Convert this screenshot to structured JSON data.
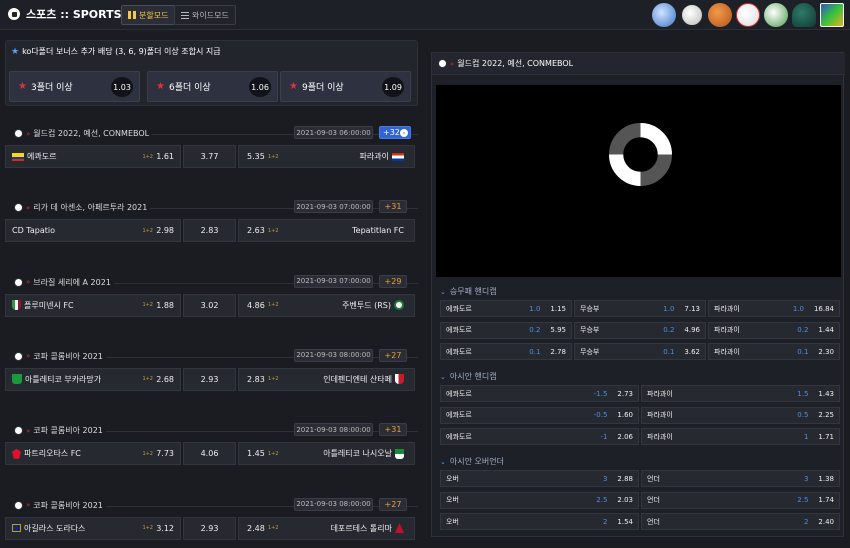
{
  "header": {
    "brand": "스포츠 :: SPORTS",
    "mode_split": "분할모드",
    "mode_wide": "와이드모드",
    "sports_icons": [
      "globe-icon",
      "soccer-ball-icon",
      "basketball-icon",
      "baseball-icon",
      "volleyball-icon",
      "hockey-helmet-icon",
      "esports-icon"
    ]
  },
  "bonus": {
    "title": "ko다폴더 보너스 추가 배당 (3, 6, 9)폴더 이상 조합시 지급",
    "items": [
      {
        "label": "3폴더 이상",
        "odds": "1.03"
      },
      {
        "label": "6폴더 이상",
        "odds": "1.06"
      },
      {
        "label": "9폴더 이상",
        "odds": "1.09"
      }
    ]
  },
  "matches": [
    {
      "league": "월드컵 2022, 예선, CONMEBOL",
      "datetime": "2021-09-03 06:00:00",
      "more": "+32",
      "home": "에콰도르",
      "home_odds": "1.61",
      "draw": "3.77",
      "away_odds": "5.35",
      "away": "파라과이",
      "tag": "1+2"
    },
    {
      "league": "리가 데 아센소, 아페르투라 2021",
      "datetime": "2021-09-03 07:00:00",
      "more": "+31",
      "home": "CD Tapatio",
      "home_odds": "2.98",
      "draw": "2.83",
      "away_odds": "2.63",
      "away": "Tepatitlan FC",
      "tag": "1+2"
    },
    {
      "league": "브라질 세리에 A 2021",
      "datetime": "2021-09-03 07:00:00",
      "more": "+29",
      "home": "플루미넨시 FC",
      "home_odds": "1.88",
      "draw": "3.02",
      "away_odds": "4.86",
      "away": "주벤투드 (RS)",
      "tag": "1+2"
    },
    {
      "league": "코파 콜롬비아 2021",
      "datetime": "2021-09-03 08:00:00",
      "more": "+27",
      "home": "아틀레티코 부카라망가",
      "home_odds": "2.68",
      "draw": "2.93",
      "away_odds": "2.83",
      "away": "인데펜디엔테 산타페",
      "tag": "1+2"
    },
    {
      "league": "코파 콜롬비아 2021",
      "datetime": "2021-09-03 08:00:00",
      "more": "+31",
      "home": "파트리오타스 FC",
      "home_odds": "7.73",
      "draw": "4.06",
      "away_odds": "1.45",
      "away": "아틀레티코 나시오날",
      "tag": "1+2"
    },
    {
      "league": "코파 콜롬비아 2021",
      "datetime": "2021-09-03 08:00:00",
      "more": "+27",
      "home": "아길라스 도라다스",
      "home_odds": "3.12",
      "draw": "2.93",
      "away_odds": "2.48",
      "away": "데포르테스 톨리마",
      "tag": "1+2"
    }
  ],
  "detail": {
    "title": "월드컵 2022, 예선, CONMEBOL",
    "market1": {
      "title": "승무패 핸디캡",
      "rows": [
        [
          {
            "l": "에콰도르",
            "h": "1.0",
            "o": "1.15"
          },
          {
            "l": "무승부",
            "h": "1.0",
            "o": "7.13"
          },
          {
            "l": "파라과이",
            "h": "1.0",
            "o": "16.84"
          }
        ],
        [
          {
            "l": "에콰도르",
            "h": "0.2",
            "o": "5.95"
          },
          {
            "l": "무승부",
            "h": "0.2",
            "o": "4.96"
          },
          {
            "l": "파라과이",
            "h": "0.2",
            "o": "1.44"
          }
        ],
        [
          {
            "l": "에콰도르",
            "h": "0.1",
            "o": "2.78"
          },
          {
            "l": "무승부",
            "h": "0.1",
            "o": "3.62"
          },
          {
            "l": "파라과이",
            "h": "0.1",
            "o": "2.30"
          }
        ]
      ]
    },
    "market2": {
      "title": "아시안 핸디캡",
      "rows": [
        [
          {
            "l": "에콰도르",
            "h": "-1.5",
            "o": "2.73"
          },
          {
            "l": "파라과이",
            "h": "1.5",
            "o": "1.43"
          }
        ],
        [
          {
            "l": "에콰도르",
            "h": "-0.5",
            "o": "1.60"
          },
          {
            "l": "파라과이",
            "h": "0.5",
            "o": "2.25"
          }
        ],
        [
          {
            "l": "에콰도르",
            "h": "-1",
            "o": "2.06"
          },
          {
            "l": "파라과이",
            "h": "1",
            "o": "1.71"
          }
        ]
      ]
    },
    "market3": {
      "title": "아시안 오버언더",
      "rows": [
        [
          {
            "l": "오버",
            "h": "3",
            "o": "2.88"
          },
          {
            "l": "언더",
            "h": "3",
            "o": "1.38"
          }
        ],
        [
          {
            "l": "오버",
            "h": "2.5",
            "o": "2.03"
          },
          {
            "l": "언더",
            "h": "2.5",
            "o": "1.74"
          }
        ],
        [
          {
            "l": "오버",
            "h": "2",
            "o": "1.54"
          },
          {
            "l": "언더",
            "h": "2",
            "o": "2.40"
          }
        ]
      ]
    }
  }
}
